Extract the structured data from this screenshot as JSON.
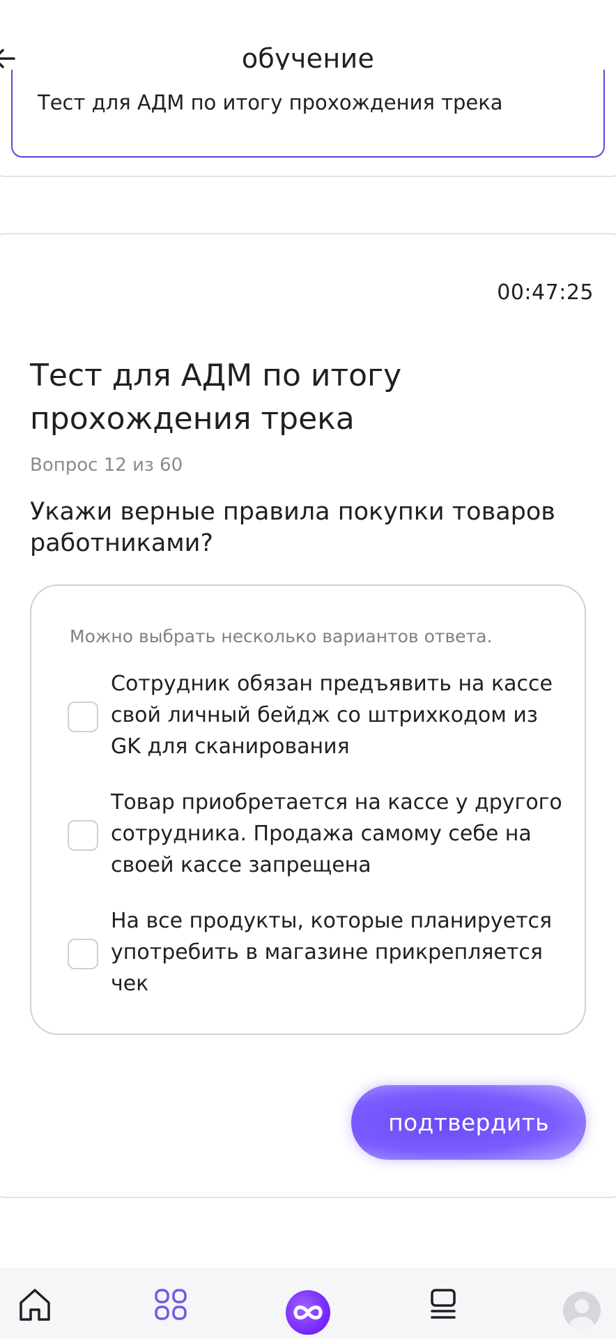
{
  "header": {
    "title": "обучение",
    "back_icon": "arrow-left-icon"
  },
  "top_card": {
    "text": "Тест для АДМ по итогу прохождения трека"
  },
  "test": {
    "timer": "00:47:25",
    "title": "Тест для АДМ по итогу прохождения трека",
    "counter": "Вопрос 12 из 60",
    "question": "Укажи верные правила покупки товаров работниками?",
    "hint": "Можно выбрать несколько вариантов ответа.",
    "options": [
      {
        "label": "Сотрудник обязан предъявить на кассе свой личный бейдж со штрихкодом из GK для сканирования",
        "checked": false
      },
      {
        "label": "Товар приобретается на кассе у другого сотрудника. Продажа самому себе на своей кассе запрещена",
        "checked": false
      },
      {
        "label": "На все продукты, которые планируется употребить в магазине прикрепляется чек",
        "checked": false
      }
    ],
    "confirm_label": "подтвердить"
  },
  "bottom_nav": {
    "items": [
      {
        "name": "home",
        "icon": "home-icon"
      },
      {
        "name": "catalog",
        "icon": "grid-icon"
      },
      {
        "name": "center",
        "icon": "infinity-icon"
      },
      {
        "name": "learning",
        "icon": "list-icon"
      },
      {
        "name": "profile",
        "icon": "avatar-icon"
      }
    ]
  },
  "colors": {
    "accent": "#5b43e0",
    "button": "#7b5cff",
    "nav_active": "#6c5ce7"
  }
}
